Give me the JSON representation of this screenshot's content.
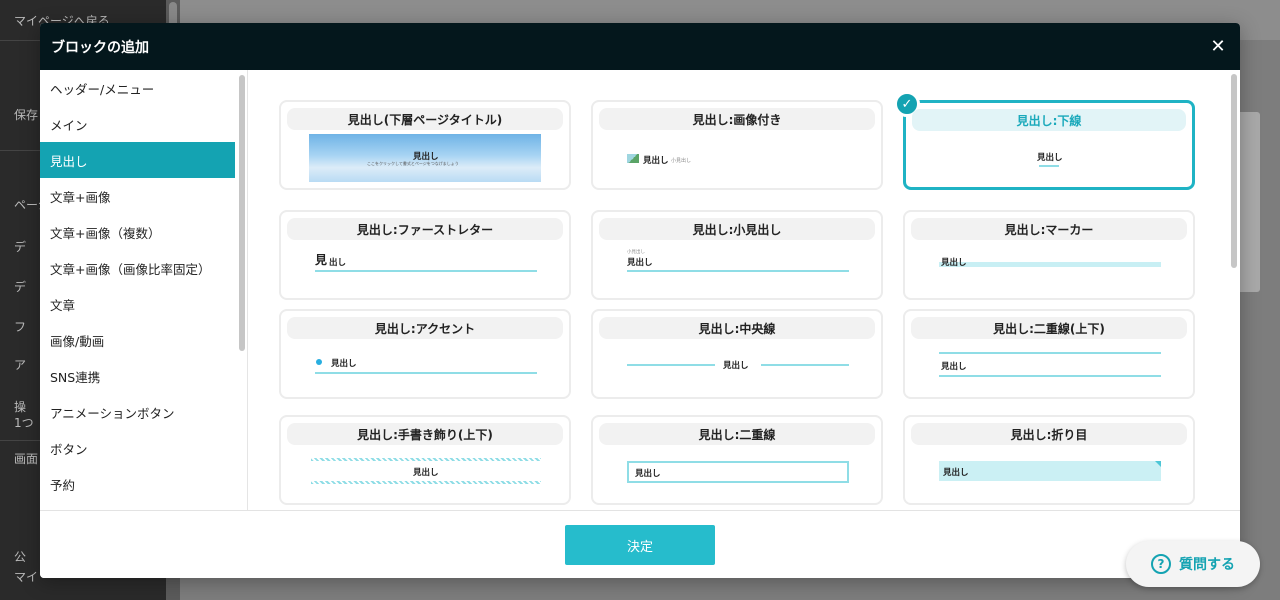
{
  "background": {
    "left_rows": [
      "マイページへ戻る",
      "保存",
      "ページ",
      "デ",
      "デ",
      "フ",
      "ア",
      "操",
      "1つ",
      "画面",
      "公",
      "マイ"
    ]
  },
  "modal": {
    "title": "ブロックの追加",
    "close_label": "✕",
    "categories": [
      {
        "label": "ヘッダー/メニュー"
      },
      {
        "label": "メイン"
      },
      {
        "label": "見出し"
      },
      {
        "label": "文章+画像"
      },
      {
        "label": "文章+画像（複数）"
      },
      {
        "label": "文章+画像（画像比率固定）"
      },
      {
        "label": "文章"
      },
      {
        "label": "画像/動画"
      },
      {
        "label": "SNS連携"
      },
      {
        "label": "アニメーションボタン"
      },
      {
        "label": "ボタン"
      },
      {
        "label": "予約"
      }
    ],
    "active_category": "見出し",
    "cards": [
      {
        "label": "見出し(下層ページタイトル)",
        "preview": "見出し",
        "preview_sub": "ここをクリックして書式とページをつなげましょう"
      },
      {
        "label": "見出し:画像付き",
        "preview": "見出し",
        "preview_sub": "小見出し"
      },
      {
        "label": "見出し:下線",
        "preview": "見出し",
        "selected": true
      },
      {
        "label": "見出し:ファーストレター",
        "preview_big": "見",
        "preview": "出し"
      },
      {
        "label": "見出し:小見出し",
        "preview": "見出し",
        "preview_sub": "小見出し"
      },
      {
        "label": "見出し:マーカー",
        "preview": "見出し"
      },
      {
        "label": "見出し:アクセント",
        "preview": "見出し"
      },
      {
        "label": "見出し:中央線",
        "preview": "見出し"
      },
      {
        "label": "見出し:二重線(上下)",
        "preview": "見出し"
      },
      {
        "label": "見出し:手書き飾り(上下)",
        "preview": "見出し"
      },
      {
        "label": "見出し:二重線",
        "preview": "見出し"
      },
      {
        "label": "見出し:折り目",
        "preview": "見出し"
      }
    ],
    "confirm_label": "決定"
  },
  "help": {
    "icon": "?",
    "label": "質問する"
  },
  "colors": {
    "accent": "#14a3b2",
    "header": "#04171c",
    "button": "#26bccc",
    "preview_line": "#8fdde6"
  }
}
